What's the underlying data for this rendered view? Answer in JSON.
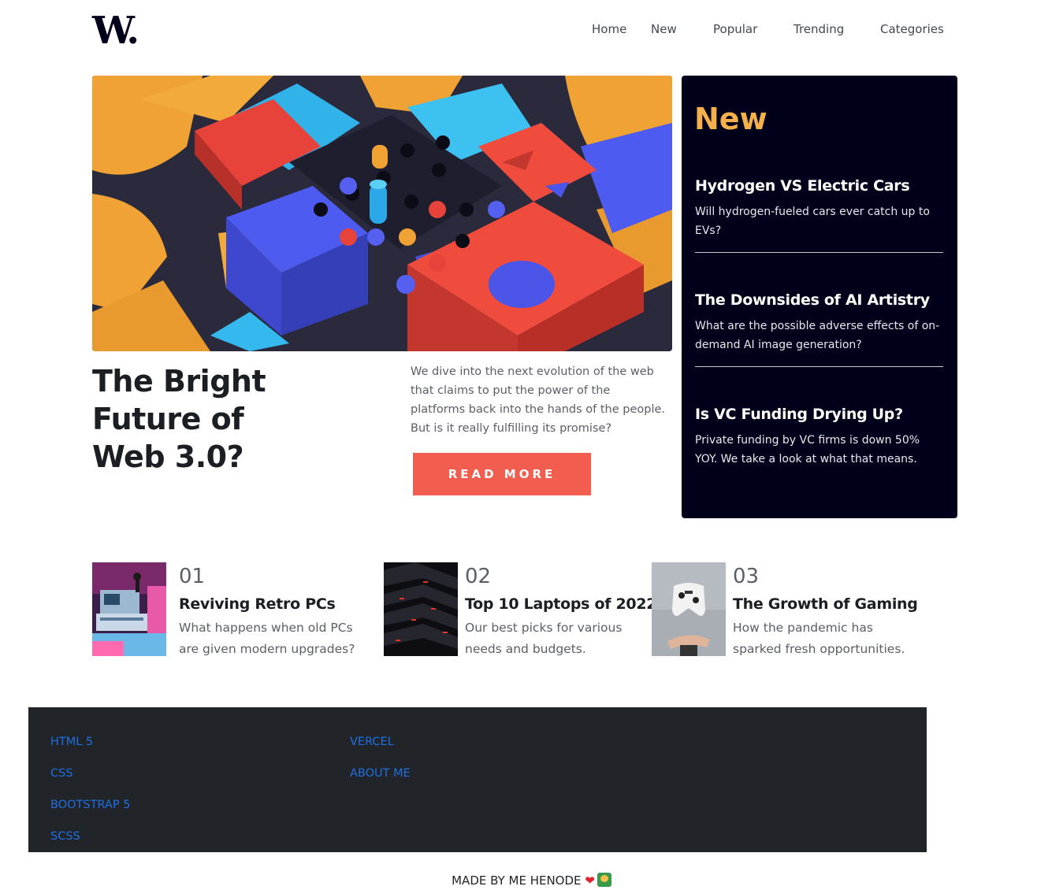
{
  "header": {
    "logo": "W.",
    "nav": [
      "Home",
      "New",
      "Popular",
      "Trending",
      "Categories"
    ]
  },
  "hero": {
    "title": "The Bright Future of Web 3.0?",
    "description": "We dive into the next evolution of the web that claims to put the power of the platforms back into the hands of the people. But is it really fulfilling its promise?",
    "button": "READ MORE"
  },
  "new_panel": {
    "heading": "New",
    "items": [
      {
        "title": "Hydrogen VS Electric Cars",
        "desc": "Will hydrogen-fueled cars ever catch up to EVs?"
      },
      {
        "title": "The Downsides of AI Artistry",
        "desc": "What are the possible adverse effects of on-demand AI image generation?"
      },
      {
        "title": "Is VC Funding Drying Up?",
        "desc": "Private funding by VC firms is down 50% YOY. We take a look at what that means."
      }
    ]
  },
  "articles": [
    {
      "num": "01",
      "title": "Reviving Retro PCs",
      "desc": "What happens when old PCs are given modern upgrades?"
    },
    {
      "num": "02",
      "title": "Top 10 Laptops of 2022",
      "desc": "Our best picks for various needs and budgets."
    },
    {
      "num": "03",
      "title": "The Growth of Gaming",
      "desc": "How the pandemic has sparked fresh opportunities."
    }
  ],
  "footer": {
    "links_col1": [
      "HTML 5",
      "CSS",
      "BOOTSTRAP 5",
      "SCSS"
    ],
    "links_col2": [
      "VERCEL",
      "ABOUT ME"
    ],
    "credit": "MADE BY ME HENODE",
    "credit_icons": [
      "heart-icon",
      "cat-emoji-icon"
    ]
  },
  "colors": {
    "accent": "#f15e50",
    "panel_bg": "#00001a",
    "new_heading": "#f4b04a",
    "footer_bg": "#212529",
    "footer_link": "#1f6fe0"
  }
}
